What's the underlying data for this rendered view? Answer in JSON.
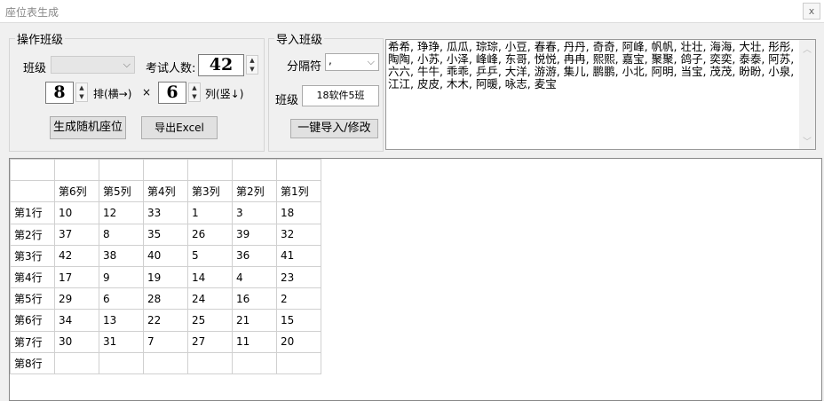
{
  "window": {
    "title": "座位表生成",
    "close": "x"
  },
  "operate": {
    "legend": "操作班级",
    "class_label": "班级",
    "class_value": "",
    "count_label": "考试人数:",
    "count_value": "42",
    "rows_value": "8",
    "rows_label": "排(横→)",
    "times": "×",
    "cols_value": "6",
    "cols_label": "列(竖↓)",
    "generate_button": "生成随机座位",
    "export_button": "导出Excel"
  },
  "import": {
    "legend": "导入班级",
    "separator_label": "分隔符",
    "separator_value": ",",
    "class_label": "班级",
    "class_value": "18软件5班",
    "import_button": "一键导入/修改",
    "names_text": "希希, 琤琤, 瓜瓜, 琮琮, 小豆, 春春, 丹丹, 奇奇, 阿峰, 帆帆, 壮壮, 海海, 大壮, 彤彤, 陶陶, 小苏, 小泽, 峰峰, 东哥, 悦悦, 冉冉, 熙熙, 嘉宝, 聚聚, 鸽子, 奕奕, 泰泰, 阿苏, 六六, 牛牛, 乖乖, 乒乒, 大洋, 游游, 集儿, 鹏鹏, 小北, 阿明, 当宝, 茂茂, 盼盼, 小泉, 江江, 皮皮, 木木, 阿暖, 咏志, 麦宝"
  },
  "grid": {
    "col_headers": [
      "第6列",
      "第5列",
      "第4列",
      "第3列",
      "第2列",
      "第1列"
    ],
    "rows": [
      {
        "label": "第1行",
        "cells": [
          "10",
          "12",
          "33",
          "1",
          "3",
          "18"
        ]
      },
      {
        "label": "第2行",
        "cells": [
          "37",
          "8",
          "35",
          "26",
          "39",
          "32"
        ]
      },
      {
        "label": "第3行",
        "cells": [
          "42",
          "38",
          "40",
          "5",
          "36",
          "41"
        ]
      },
      {
        "label": "第4行",
        "cells": [
          "17",
          "9",
          "19",
          "14",
          "4",
          "23"
        ]
      },
      {
        "label": "第5行",
        "cells": [
          "29",
          "6",
          "28",
          "24",
          "16",
          "2"
        ]
      },
      {
        "label": "第6行",
        "cells": [
          "34",
          "13",
          "22",
          "25",
          "21",
          "15"
        ]
      },
      {
        "label": "第7行",
        "cells": [
          "30",
          "31",
          "7",
          "27",
          "11",
          "20"
        ]
      },
      {
        "label": "第8行",
        "cells": [
          "",
          "",
          "",
          "",
          "",
          ""
        ]
      }
    ]
  }
}
